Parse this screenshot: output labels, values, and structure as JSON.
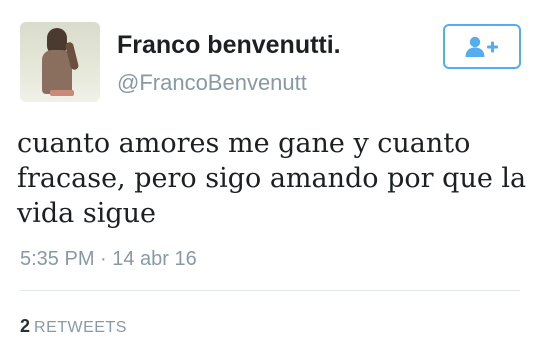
{
  "author": {
    "name": "Franco benvenutti.",
    "handle": "@FrancoBenvenutt",
    "avatar_icon": "profile-photo"
  },
  "follow_button": {
    "icon": "follow-user-plus-icon",
    "color": "#55acee"
  },
  "tweet": {
    "text": "cuanto amores me gane y cuanto fracase, pero sigo amando por que la vida sigue",
    "timestamp": "5:35 PM · 14 abr 16"
  },
  "stats": {
    "retweet_count": "2",
    "retweet_label": "RETWEETS"
  },
  "colors": {
    "accent": "#55acee",
    "muted_text": "#8899a6",
    "primary_text": "#1c2022"
  }
}
